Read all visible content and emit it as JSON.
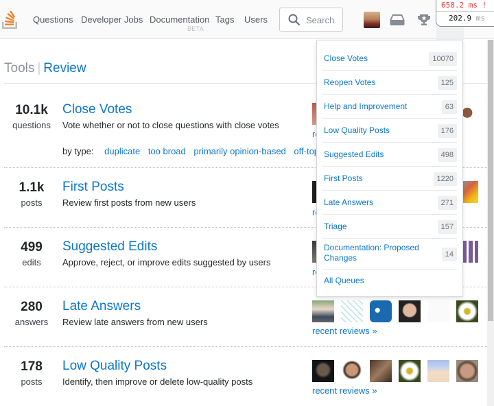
{
  "nav": {
    "items": [
      {
        "label": "Questions"
      },
      {
        "label": "Developer Jobs"
      },
      {
        "label": "Documentation",
        "sub": "BETA"
      },
      {
        "label": "Tags"
      },
      {
        "label": "Users"
      }
    ],
    "search_placeholder": "Search"
  },
  "profiler": {
    "row1_value": "658.2 ms !",
    "row2_value": "202.9",
    "row2_unit": "ms"
  },
  "page": {
    "crumb_tools": "Tools",
    "crumb_sep": "|",
    "crumb_review": "Review"
  },
  "queues": [
    {
      "count": "10.1k",
      "unit": "questions",
      "title": "Close Votes",
      "description": "Vote whether or not to close questions with close votes",
      "by_type_label": "by type:",
      "types": [
        "duplicate",
        "too broad",
        "primarily opinion-based",
        "off-topic"
      ],
      "recent": "recent reviews »"
    },
    {
      "count": "1.1k",
      "unit": "posts",
      "title": "First Posts",
      "description": "Review first posts from new users",
      "recent": "recent reviews »"
    },
    {
      "count": "499",
      "unit": "edits",
      "title": "Suggested Edits",
      "description": "Approve, reject, or improve edits suggested by users",
      "recent": "recent reviews »"
    },
    {
      "count": "280",
      "unit": "answers",
      "title": "Late Answers",
      "description": "Review late answers from new users",
      "recent": "recent reviews »"
    },
    {
      "count": "178",
      "unit": "posts",
      "title": "Low Quality Posts",
      "description": "Identify, then improve or delete low-quality posts",
      "recent": "recent reviews »"
    }
  ],
  "dropdown": {
    "items": [
      {
        "label": "Close Votes",
        "count": "10070"
      },
      {
        "label": "Reopen Votes",
        "count": "125"
      },
      {
        "label": "Help and Improvement",
        "count": "63"
      },
      {
        "label": "Low Quality Posts",
        "count": "176"
      },
      {
        "label": "Suggested Edits",
        "count": "498"
      },
      {
        "label": "First Posts",
        "count": "1220"
      },
      {
        "label": "Late Answers",
        "count": "271"
      },
      {
        "label": "Triage",
        "count": "157"
      },
      {
        "label": "Documentation: Proposed Changes",
        "count": "14"
      }
    ],
    "all_queues": "All Queues"
  },
  "colors": {
    "link": "#0c76cc",
    "brand_orange": "#f48024",
    "profiler_alert": "#e33333"
  }
}
